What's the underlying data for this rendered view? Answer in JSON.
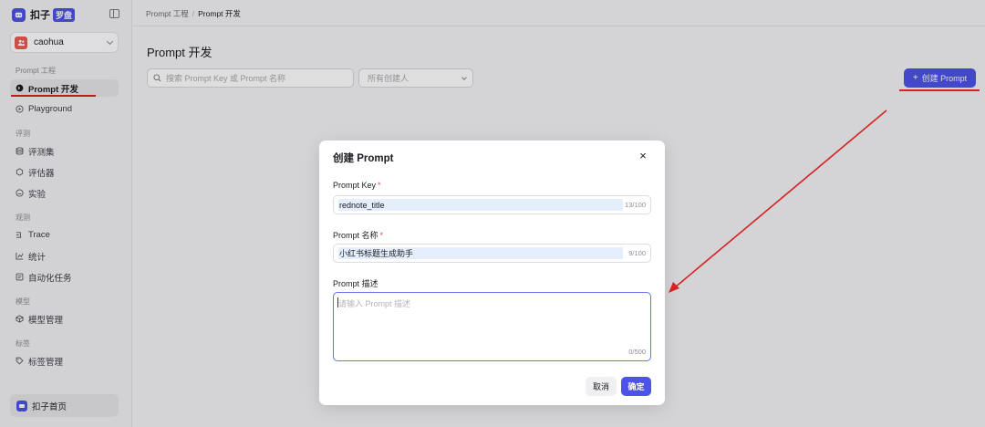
{
  "brand": {
    "name": "扣子",
    "badge": "罗盘"
  },
  "workspace": {
    "name": "caohua"
  },
  "sidebar": {
    "sections": [
      {
        "label": "Prompt 工程"
      },
      {
        "label": "评测"
      },
      {
        "label": "观测"
      },
      {
        "label": "模型"
      },
      {
        "label": "标签"
      }
    ],
    "items": [
      {
        "label": "Prompt 开发",
        "icon": "prompt-icon"
      },
      {
        "label": "Playground",
        "icon": "playground-icon"
      },
      {
        "label": "评测集",
        "icon": "database-icon"
      },
      {
        "label": "评估器",
        "icon": "evaluator-icon"
      },
      {
        "label": "实验",
        "icon": "experiment-icon"
      },
      {
        "label": "Trace",
        "icon": "trace-icon"
      },
      {
        "label": "统计",
        "icon": "chart-icon"
      },
      {
        "label": "自动化任务",
        "icon": "task-icon"
      },
      {
        "label": "模型管理",
        "icon": "model-icon"
      },
      {
        "label": "标签管理",
        "icon": "tag-icon"
      }
    ],
    "home_label": "扣子首页"
  },
  "breadcrumb": {
    "parent": "Prompt 工程",
    "separator": "/",
    "current": "Prompt 开发"
  },
  "page": {
    "title": "Prompt 开发",
    "search_placeholder": "搜索 Prompt Key 或 Prompt 名称",
    "creator_filter": "所有创建人",
    "create_button": "创建 Prompt",
    "create_plus": "+"
  },
  "modal": {
    "title": "创建 Prompt",
    "close": "×",
    "key_label": "Prompt Key",
    "key_value": "rednote_title",
    "key_count": "13/100",
    "name_label": "Prompt 名称",
    "name_value": "小红书标题生成助手",
    "name_count": "9/100",
    "required_mark": "*",
    "desc_label": "Prompt 描述",
    "desc_placeholder": "请输入 Prompt 描述",
    "desc_count": "0/500",
    "cancel_label": "取消",
    "ok_label": "确定"
  },
  "colors": {
    "accent": "#4d53e8",
    "annotation": "#d62222",
    "required": "#e5484d"
  }
}
